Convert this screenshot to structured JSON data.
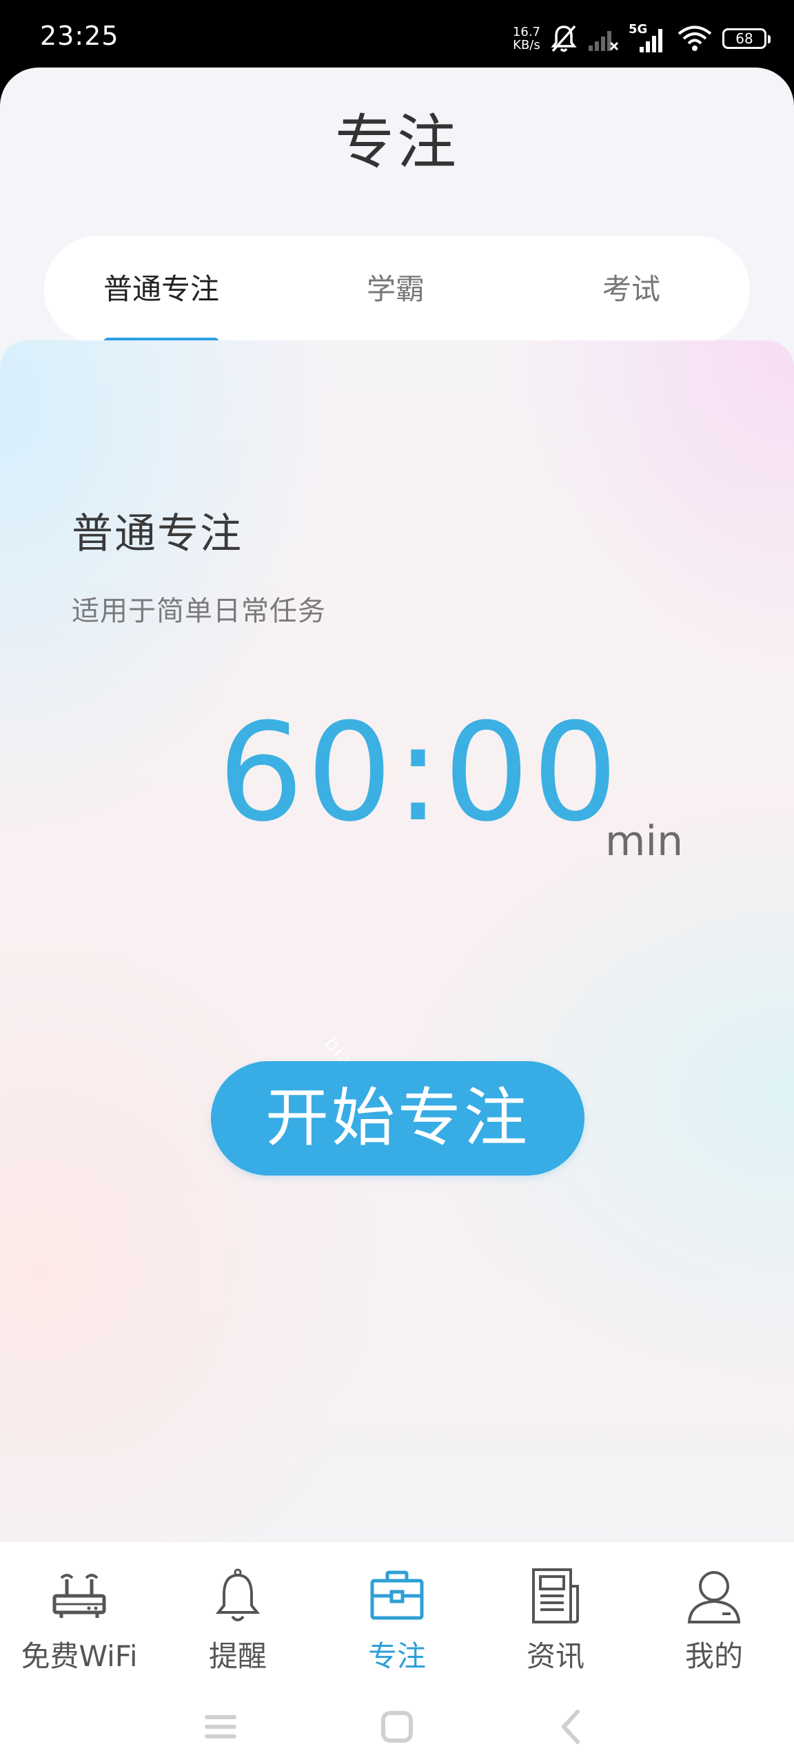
{
  "status_bar": {
    "time": "23:25",
    "net_speed_value": "16.7",
    "net_speed_unit": "KB/s",
    "network_label": "5G",
    "battery": "68"
  },
  "header": {
    "title": "专注"
  },
  "tabs": [
    {
      "label": "普通专注",
      "active": true
    },
    {
      "label": "学霸",
      "active": false
    },
    {
      "label": "考试",
      "active": false
    }
  ],
  "card": {
    "mode_title": "普通专注",
    "mode_description": "适用于简单日常任务",
    "timer": "60:00",
    "timer_unit": "min",
    "watermark": "bianzy.top",
    "start_button_label": "开始专注"
  },
  "bottom_nav": [
    {
      "label": "免费WiFi",
      "icon": "router-icon",
      "active": false
    },
    {
      "label": "提醒",
      "icon": "bell-icon",
      "active": false
    },
    {
      "label": "专注",
      "icon": "briefcase-icon",
      "active": true
    },
    {
      "label": "资讯",
      "icon": "newspaper-icon",
      "active": false
    },
    {
      "label": "我的",
      "icon": "user-icon",
      "active": false
    }
  ],
  "colors": {
    "accent": "#38ace4",
    "timer": "#3cb0e2",
    "tab_indicator": "#2f9fe6"
  }
}
